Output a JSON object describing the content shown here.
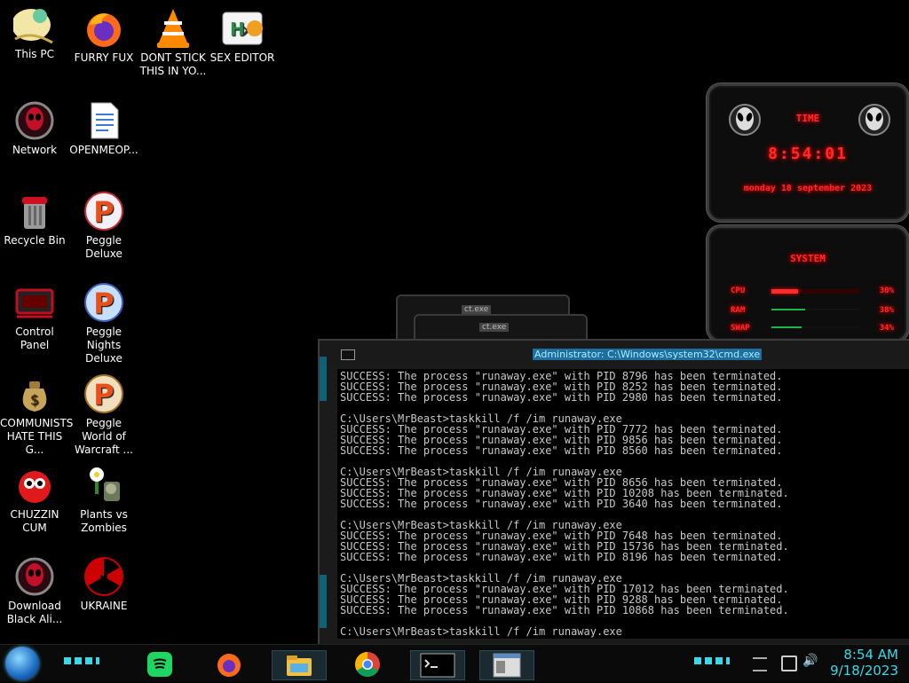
{
  "desktop_icons": [
    {
      "label": "This PC"
    },
    {
      "label": "FURRY FUX"
    },
    {
      "label": "DONT STICK THIS IN YO..."
    },
    {
      "label": "SEX EDITOR"
    },
    {
      "label": "Network"
    },
    {
      "label": "OPENMEOP..."
    },
    {
      "label": "Recycle Bin"
    },
    {
      "label": "Peggle Deluxe"
    },
    {
      "label": "Control Panel"
    },
    {
      "label": "Peggle Nights Deluxe"
    },
    {
      "label": "COMMUNISTS HATE THIS G..."
    },
    {
      "label": "Peggle World of Warcraft ..."
    },
    {
      "label": "CHUZZIN CUM"
    },
    {
      "label": "Plants vs Zombies"
    },
    {
      "label": "Download Black Ali..."
    },
    {
      "label": "UKRAINE"
    }
  ],
  "time_widget": {
    "title": "TIME",
    "time": "8:54:01",
    "date": "monday 18 september 2023"
  },
  "system_widget": {
    "title": "SYSTEM",
    "rows": [
      {
        "label": "CPU",
        "value": "30%",
        "fill": 0.3
      },
      {
        "label": "RAM",
        "value": "38%",
        "fill": 0.38
      },
      {
        "label": "SWAP",
        "value": "34%",
        "fill": 0.34
      }
    ]
  },
  "small_windows": [
    {
      "label": "ct.exe"
    },
    {
      "label": "ct.exe"
    }
  ],
  "cmd": {
    "title": "Administrator: C:\\Windows\\system32\\cmd.exe",
    "lines": [
      "SUCCESS: The process \"runaway.exe\" with PID 8796 has been terminated.",
      "SUCCESS: The process \"runaway.exe\" with PID 8252 has been terminated.",
      "SUCCESS: The process \"runaway.exe\" with PID 2980 has been terminated.",
      "",
      "C:\\Users\\MrBeast>taskkill /f /im runaway.exe",
      "SUCCESS: The process \"runaway.exe\" with PID 7772 has been terminated.",
      "SUCCESS: The process \"runaway.exe\" with PID 9856 has been terminated.",
      "SUCCESS: The process \"runaway.exe\" with PID 8560 has been terminated.",
      "",
      "C:\\Users\\MrBeast>taskkill /f /im runaway.exe",
      "SUCCESS: The process \"runaway.exe\" with PID 8656 has been terminated.",
      "SUCCESS: The process \"runaway.exe\" with PID 10208 has been terminated.",
      "SUCCESS: The process \"runaway.exe\" with PID 3640 has been terminated.",
      "",
      "C:\\Users\\MrBeast>taskkill /f /im runaway.exe",
      "SUCCESS: The process \"runaway.exe\" with PID 7648 has been terminated.",
      "SUCCESS: The process \"runaway.exe\" with PID 15736 has been terminated.",
      "SUCCESS: The process \"runaway.exe\" with PID 8196 has been terminated.",
      "",
      "C:\\Users\\MrBeast>taskkill /f /im runaway.exe",
      "SUCCESS: The process \"runaway.exe\" with PID 17012 has been terminated.",
      "SUCCESS: The process \"runaway.exe\" with PID 9288 has been terminated.",
      "SUCCESS: The process \"runaway.exe\" with PID 10868 has been terminated.",
      "",
      "C:\\Users\\MrBeast>taskkill /f /im runaway.exe"
    ]
  },
  "taskbar": {
    "items": [
      {
        "icon": "start-orb-icon"
      },
      {
        "icon": "spotify-icon"
      },
      {
        "icon": "firefox-icon"
      },
      {
        "icon": "file-explorer-icon"
      },
      {
        "icon": "chrome-icon"
      },
      {
        "icon": "command-prompt-icon"
      },
      {
        "icon": "window-app-icon"
      }
    ],
    "time": "8:54 AM",
    "date": "9/18/2023"
  },
  "colors": {
    "accent_cyan": "#3ad9e8",
    "neon_red": "#ff2a2a"
  }
}
